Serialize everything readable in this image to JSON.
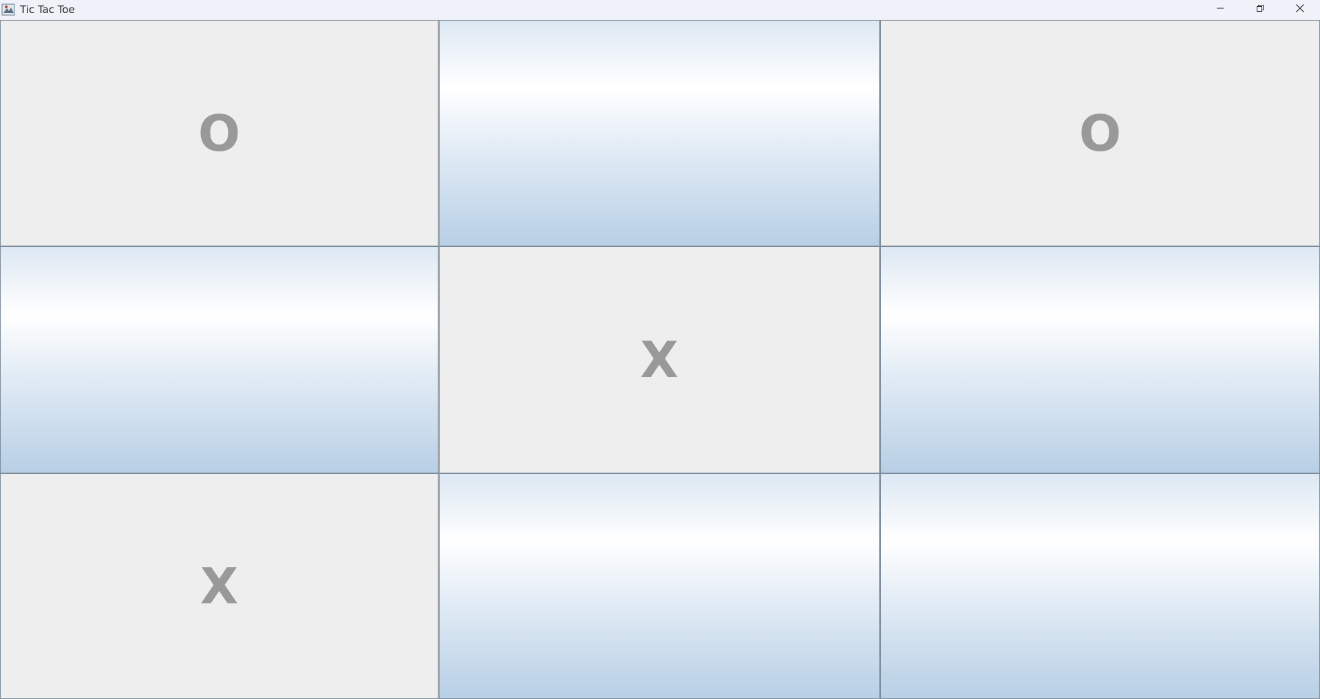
{
  "window": {
    "title": "Tic Tac Toe"
  },
  "board": {
    "cells": [
      {
        "mark": "O",
        "state": "filled"
      },
      {
        "mark": "",
        "state": "empty"
      },
      {
        "mark": "O",
        "state": "filled"
      },
      {
        "mark": "",
        "state": "empty"
      },
      {
        "mark": "X",
        "state": "filled"
      },
      {
        "mark": "",
        "state": "empty"
      },
      {
        "mark": "X",
        "state": "filled"
      },
      {
        "mark": "",
        "state": "empty"
      },
      {
        "mark": "",
        "state": "empty"
      }
    ]
  },
  "colors": {
    "mark": "#999999",
    "filled_bg": "#eeeeee",
    "empty_gradient_top": "#dde8f3",
    "empty_gradient_highlight": "#ffffff",
    "empty_gradient_bottom": "#b8cfe5"
  },
  "icons": {
    "app": "java-app-icon",
    "minimize": "minimize-icon",
    "maximize": "restore-icon",
    "close": "close-icon"
  }
}
